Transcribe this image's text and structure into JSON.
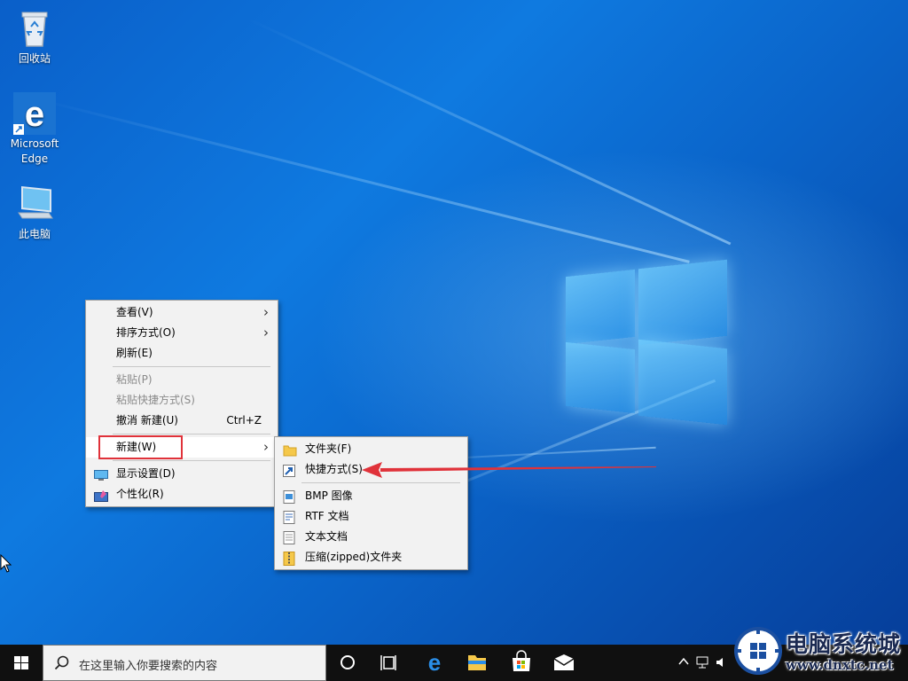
{
  "desktop": {
    "icons": [
      {
        "label": "回收站"
      },
      {
        "label": "Microsoft Edge"
      },
      {
        "label": "此电脑"
      }
    ]
  },
  "context_menu": {
    "items": [
      {
        "label": "查看(V)",
        "has_submenu": true
      },
      {
        "label": "排序方式(O)",
        "has_submenu": true
      },
      {
        "label": "刷新(E)"
      },
      {
        "label": "粘贴(P)",
        "disabled": true
      },
      {
        "label": "粘贴快捷方式(S)",
        "disabled": true
      },
      {
        "label": "撤消 新建(U)",
        "shortcut": "Ctrl+Z"
      },
      {
        "label": "新建(W)",
        "has_submenu": true,
        "highlighted": true
      },
      {
        "label": "显示设置(D)",
        "icon": "display-icon"
      },
      {
        "label": "个性化(R)",
        "icon": "personalize-icon"
      }
    ]
  },
  "new_submenu": {
    "items": [
      {
        "label": "文件夹(F)",
        "icon": "folder-icon"
      },
      {
        "label": "快捷方式(S)",
        "icon": "shortcut-icon"
      },
      {
        "label": "BMP 图像",
        "icon": "bmp-icon"
      },
      {
        "label": "RTF 文档",
        "icon": "rtf-icon"
      },
      {
        "label": "文本文档",
        "icon": "text-doc-icon"
      },
      {
        "label": "压缩(zipped)文件夹",
        "icon": "zip-folder-icon"
      }
    ]
  },
  "taskbar": {
    "search_placeholder": "在这里输入你要搜索的内容"
  },
  "watermark": {
    "title": "电脑系统城",
    "url": "www.dnxtc.net"
  },
  "colors": {
    "highlight_box": "#e0323a",
    "annotation_arrow": "#e0323a",
    "taskbar": "#101010"
  }
}
